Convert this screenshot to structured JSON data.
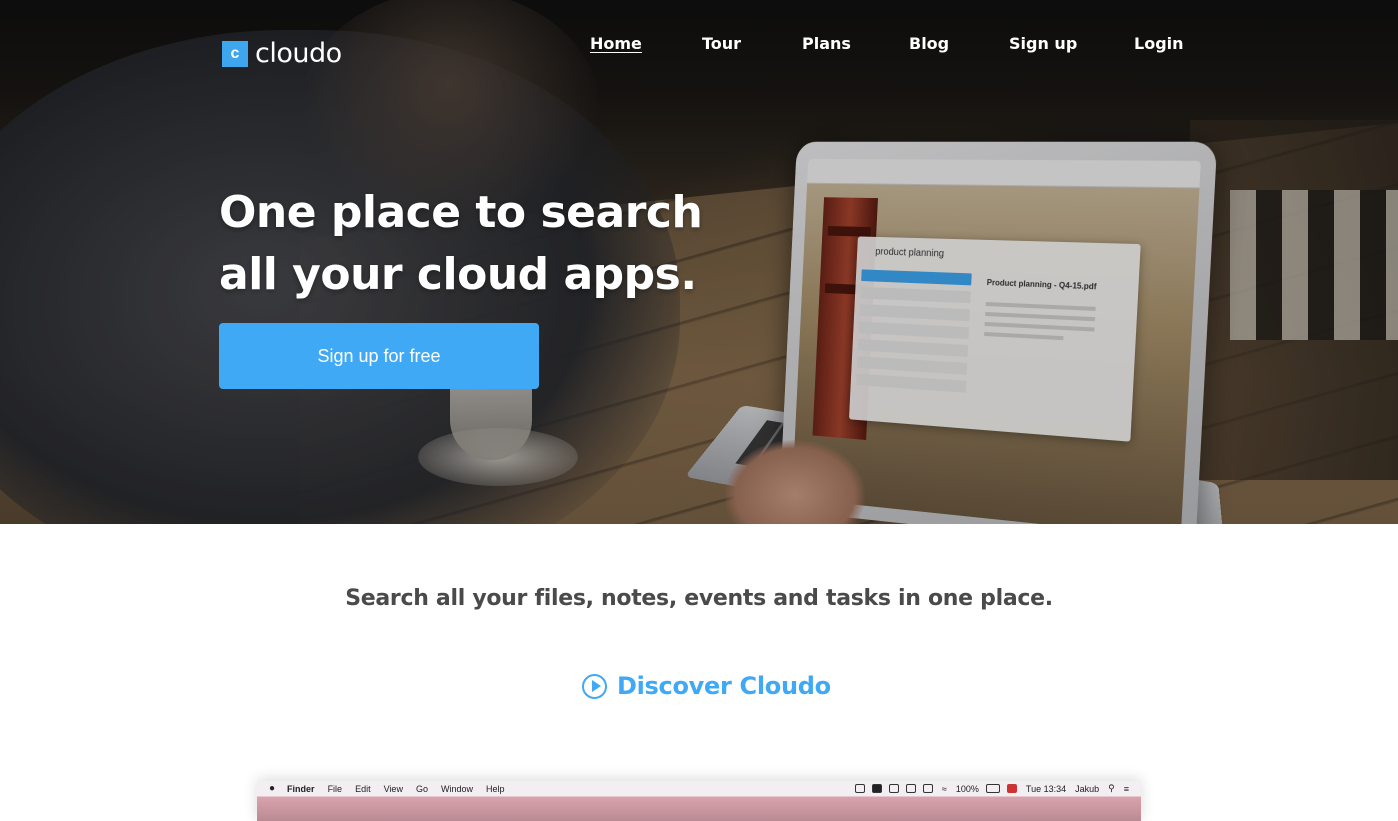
{
  "brand": {
    "logo_letter": "c",
    "name": "cloudo",
    "accent_color": "#3fa9f5"
  },
  "nav": {
    "items": [
      {
        "label": "Home",
        "active": true
      },
      {
        "label": "Tour",
        "active": false
      },
      {
        "label": "Plans",
        "active": false
      },
      {
        "label": "Blog",
        "active": false
      },
      {
        "label": "Sign up",
        "active": false
      },
      {
        "label": "Login",
        "active": false
      }
    ]
  },
  "hero": {
    "headline_line1": "One place to search",
    "headline_line2": "all your cloud apps.",
    "cta_label": "Sign up for free",
    "laptop_screen": {
      "search_query": "product planning",
      "preview_title": "Product planning - Q4-15.pdf"
    }
  },
  "features": {
    "tagline": "Search all your files, notes, events and tasks in one place.",
    "discover_label": "Discover Cloudo"
  },
  "mac_preview": {
    "menu_items": [
      "Finder",
      "File",
      "Edit",
      "View",
      "Go",
      "Window",
      "Help"
    ],
    "battery": "100%",
    "clock": "Tue 13:34",
    "user": "Jakub"
  }
}
